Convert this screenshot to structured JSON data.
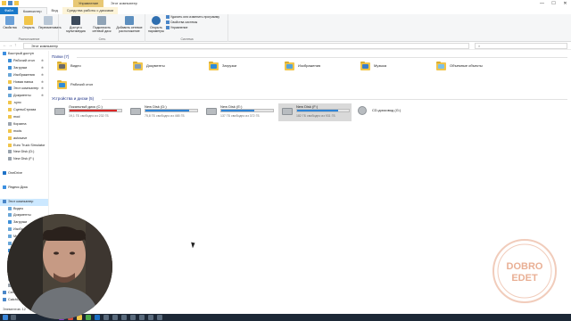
{
  "titlebar": {
    "context_tab": "Управление",
    "title": "Этот компьютер",
    "minimize": "—",
    "maximize": "☐",
    "close": "✕"
  },
  "ribbon_tabs": [
    "Файл",
    "Компьютер",
    "Вид",
    "Средства работы с дисками"
  ],
  "ribbon": {
    "group_location": {
      "label": "Расположение",
      "buttons": [
        "Свойства",
        "Открыть",
        "Переименовать"
      ]
    },
    "group_network": {
      "label": "Сеть",
      "buttons": [
        "Доступ к мультимедиа",
        "Подключить сетевой диск",
        "Добавить сетевое расположение"
      ]
    },
    "group_system": {
      "label": "Система",
      "open_params": "Открыть параметры",
      "small": [
        "Удалить или изменить программу",
        "Свойства системы",
        "Управление"
      ]
    }
  },
  "address": {
    "path": "Этот компьютер",
    "search_placeholder": ""
  },
  "nav_pane": {
    "items": [
      {
        "label": "Быстрый доступ",
        "color": "#3c8ee0",
        "indent": 0
      },
      {
        "label": "Рабочий стол",
        "color": "#3d8fd8",
        "indent": 1,
        "pin": true
      },
      {
        "label": "Загрузки",
        "color": "#3d8fd8",
        "indent": 1,
        "pin": true
      },
      {
        "label": "Изображения",
        "color": "#6aa6d8",
        "indent": 1,
        "pin": true
      },
      {
        "label": "Новая папка",
        "color": "#f1c54a",
        "indent": 1,
        "pin": true
      },
      {
        "label": "Этот компьютер",
        "color": "#4a86c8",
        "indent": 1,
        "pin": true
      },
      {
        "label": "Документы",
        "color": "#6aa6d8",
        "indent": 1,
        "pin": true
      },
      {
        "label": ".sync",
        "color": "#f1c54a",
        "indent": 1
      },
      {
        "label": "СценыСтрима",
        "color": "#f1c54a",
        "indent": 1
      },
      {
        "label": "mod",
        "color": "#f1c54a",
        "indent": 1
      },
      {
        "label": "Корзина",
        "color": "#9aa3ad",
        "indent": 1
      },
      {
        "label": "mods",
        "color": "#f1c54a",
        "indent": 1
      },
      {
        "label": "autosave",
        "color": "#f1c54a",
        "indent": 1
      },
      {
        "label": "Euro Truck Simulator",
        "color": "#f1c54a",
        "indent": 1
      },
      {
        "label": "New Disk (D:)",
        "color": "#9aa3ad",
        "indent": 1
      },
      {
        "label": "New Disk (F:)",
        "color": "#9aa3ad",
        "indent": 1
      },
      {
        "label": "",
        "color": "",
        "indent": 0
      },
      {
        "label": "OneDrive",
        "color": "#1f72c7",
        "indent": 0
      },
      {
        "label": "",
        "color": "",
        "indent": 0
      },
      {
        "label": "Яндекс.Диск",
        "color": "#3b8fe0",
        "indent": 0
      },
      {
        "label": "",
        "color": "",
        "indent": 0
      },
      {
        "label": "Этот компьютер",
        "color": "#4a86c8",
        "indent": 0,
        "selected": true
      },
      {
        "label": "Видео",
        "color": "#6aa6d8",
        "indent": 1
      },
      {
        "label": "Документы",
        "color": "#6aa6d8",
        "indent": 1
      },
      {
        "label": "Загрузки",
        "color": "#3d8fd8",
        "indent": 1
      },
      {
        "label": "Изображения",
        "color": "#6aa6d8",
        "indent": 1
      },
      {
        "label": "Музыка",
        "color": "#6aa6d8",
        "indent": 1
      },
      {
        "label": "Объемные объекты",
        "color": "#6aa6d8",
        "indent": 1
      },
      {
        "label": "Рабочий стол",
        "color": "#3d8fd8",
        "indent": 1
      },
      {
        "label": "Локальный диск (C:)",
        "color": "#9aa3ad",
        "indent": 1
      },
      {
        "label": "New Disk (D:)",
        "color": "#9aa3ad",
        "indent": 1
      },
      {
        "label": "New Disk (E:)",
        "color": "#9aa3ad",
        "indent": 1
      },
      {
        "label": "New Disk (F:)",
        "color": "#9aa3ad",
        "indent": 1
      },
      {
        "label": "CD-дисковод (G:)",
        "color": "#9aa3ad",
        "indent": 1
      },
      {
        "label": "Сеть",
        "color": "#4a86c8",
        "indent": 0
      },
      {
        "label": "CatchCam",
        "color": "#4a86c8",
        "indent": 0
      }
    ]
  },
  "folders_section": {
    "title": "Папки (7)",
    "items": [
      {
        "label": "Видео",
        "badge": "#6b6b6b"
      },
      {
        "label": "Документы",
        "badge": "#7f9bb8"
      },
      {
        "label": "Загрузки",
        "badge": "#2f8cd8"
      },
      {
        "label": "Изображения",
        "badge": "#58a4d8"
      },
      {
        "label": "Музыка",
        "badge": "#3b7ec8"
      },
      {
        "label": "Объемные объекты",
        "badge": "#7dc0e8"
      },
      {
        "label": "Рабочий стол",
        "badge": "#2f8cd8"
      }
    ]
  },
  "drives_section": {
    "title": "Устройства и диски (5)",
    "items": [
      {
        "name": "Локальный диск (C:)",
        "free": "19,1 ГБ свободно из 232 ГБ",
        "used_fraction": 0.92,
        "color": "#da2626"
      },
      {
        "name": "New Disk (D:)",
        "free": "75,8 ГБ свободно из 465 ГБ",
        "used_fraction": 0.84,
        "color": "#2f84d6"
      },
      {
        "name": "New Disk (E:)",
        "free": "137 ГБ свободно из 372 ГБ",
        "used_fraction": 0.63,
        "color": "#2f84d6"
      },
      {
        "name": "New Disk (F:)",
        "free": "182 ГБ свободно из 931 ГБ",
        "used_fraction": 0.8,
        "color": "#2f84d6"
      },
      {
        "name": "CD-дисковод (G:)",
        "free": "",
        "used_fraction": null,
        "color": ""
      }
    ]
  },
  "status": {
    "items_count": "Элементов: 12"
  },
  "logo": {
    "line1": "DOBRO",
    "line2": "EDET"
  }
}
